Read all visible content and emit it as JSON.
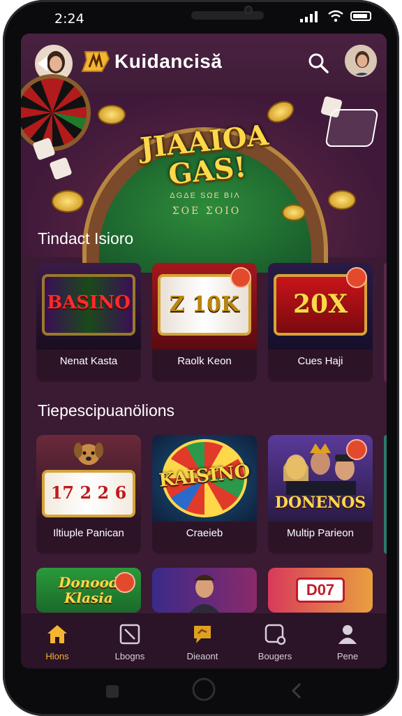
{
  "status": {
    "time": "2:24"
  },
  "app": {
    "title": "Kuidancisă"
  },
  "hero": {
    "title": "JIAAIOA GAS!",
    "subtitle_line1": "ΔGΔΕ SΩΕ ΒΙΛ",
    "subtitle_line2": "ΣΟΕ ΣΟΙΟ"
  },
  "section1": {
    "title": "Tindact Isioro",
    "cards": [
      {
        "art_text": "BASINO",
        "label": "Nenat Kasta"
      },
      {
        "art_text": "Z 10K",
        "label": "Raolk Keon"
      },
      {
        "art_text": "20X",
        "label": "Cues Haji"
      }
    ]
  },
  "section2": {
    "title": "Tiepescipuanölions",
    "cards": [
      {
        "art_text": "17 2 2 6",
        "label": "Iltiuple Panican"
      },
      {
        "art_text": "KAISINO",
        "label": "Craeieb"
      },
      {
        "art_text": "DONENOS",
        "label": "Multip Parieon"
      }
    ]
  },
  "section3": {
    "cards": [
      {
        "art_text": "Donood Klasia"
      },
      {
        "art_text": ""
      },
      {
        "art_text": "D07"
      }
    ]
  },
  "nav": [
    {
      "label": "Hlons",
      "icon": "home-icon",
      "active": true
    },
    {
      "label": "Lbogns",
      "icon": "slash-box-icon",
      "active": false
    },
    {
      "label": "Dieaont",
      "icon": "chat-icon",
      "active": false
    },
    {
      "label": "Bougers",
      "icon": "box-badge-icon",
      "active": false
    },
    {
      "label": "Pene",
      "icon": "person-icon",
      "active": false
    }
  ],
  "colors": {
    "accent": "#f4b531",
    "background": "#3b1a33",
    "nav_bg": "#2b1328"
  }
}
